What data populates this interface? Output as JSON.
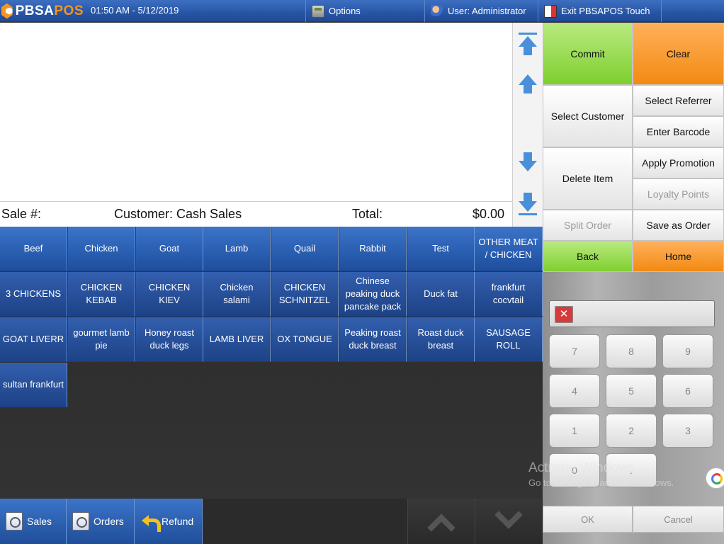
{
  "topbar": {
    "brand_left": "PBSA",
    "brand_right": "POS",
    "datetime": "01:50 AM - 5/12/2019",
    "options_label": "Options",
    "user_label": "User: Administrator",
    "exit_label": "Exit PBSAPOS Touch"
  },
  "summary": {
    "sale_label": "Sale #:",
    "customer_label": "Customer: Cash Sales",
    "total_label": "Total:",
    "total_value": "$0.00"
  },
  "categories": [
    "Beef",
    "Chicken",
    "Goat",
    "Lamb",
    "Quail",
    "Rabbit",
    "Test",
    "OTHER MEAT / CHICKEN"
  ],
  "items": [
    "3 CHICKENS",
    "CHICKEN KEBAB",
    "CHICKEN KIEV",
    "Chicken salami",
    "CHICKEN SCHNITZEL",
    "Chinese peaking duck pancake pack",
    "Duck fat",
    "frankfurt cocvtail",
    "GOAT LIVERR",
    "gourmet lamb pie",
    "Honey roast duck legs",
    "LAMB LIVER",
    "OX TONGUE",
    "Peaking roast duck breast",
    "Roast duck breast",
    "SAUSAGE ROLL",
    "sultan frankfurt"
  ],
  "actions": {
    "commit": "Commit",
    "clear": "Clear",
    "select_customer": "Select Customer",
    "select_referrer": "Select Referrer",
    "enter_barcode": "Enter Barcode",
    "delete_item": "Delete Item",
    "apply_promotion": "Apply Promotion",
    "loyalty_points": "Loyalty Points",
    "split_order": "Split Order",
    "save_as_order": "Save as Order",
    "back": "Back",
    "home": "Home"
  },
  "keypad": {
    "keys": [
      "7",
      "8",
      "9",
      "4",
      "5",
      "6",
      "1",
      "2",
      "3",
      "0",
      "."
    ],
    "ok": "OK",
    "cancel": "Cancel"
  },
  "bottombar": {
    "sales": "Sales",
    "orders": "Orders",
    "refund": "Refund"
  },
  "watermark": {
    "title": "Activate Windows",
    "subtitle": "Go to Settings to activate Windows."
  },
  "colors": {
    "tile_blue": "#2a5fb2",
    "accent_green": "#7fcf2f",
    "accent_orange": "#f28a12",
    "brand_orange": "#f7941d"
  }
}
